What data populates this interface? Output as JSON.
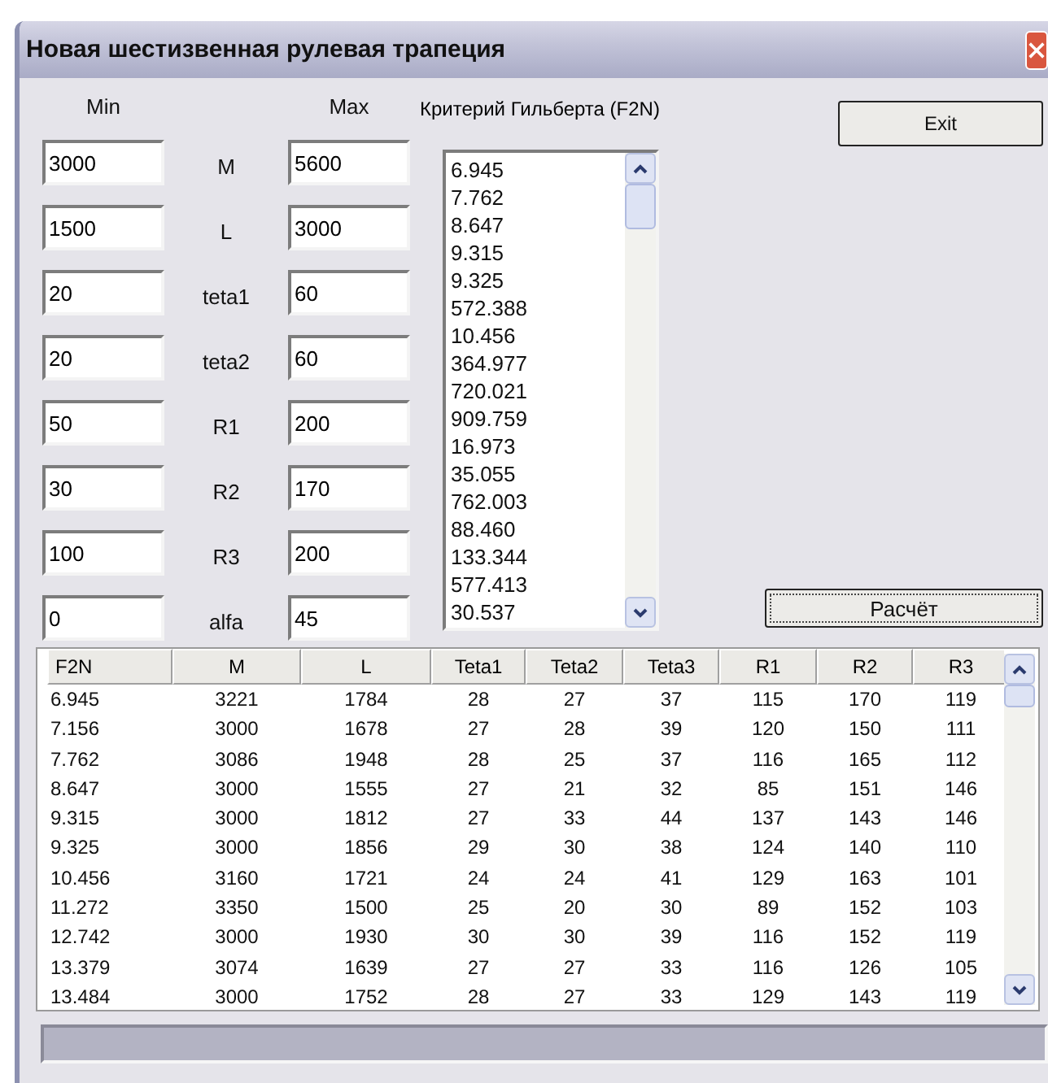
{
  "window": {
    "title": "Новая шестизвенная рулевая трапеция"
  },
  "params": {
    "min_header": "Min",
    "max_header": "Max",
    "rows": [
      {
        "min": "3000",
        "label": "M",
        "max": "5600"
      },
      {
        "min": "1500",
        "label": "L",
        "max": "3000"
      },
      {
        "min": "20",
        "label": "teta1",
        "max": "60"
      },
      {
        "min": "20",
        "label": "teta2",
        "max": "60"
      },
      {
        "min": "50",
        "label": "R1",
        "max": "200"
      },
      {
        "min": "30",
        "label": "R2",
        "max": "170"
      },
      {
        "min": "100",
        "label": "R3",
        "max": "200"
      },
      {
        "min": "0",
        "label": "alfa",
        "max": "45"
      }
    ]
  },
  "criterion": {
    "label": "Критерий Гильберта (F2N)",
    "items": [
      "6.945",
      "7.762",
      "8.647",
      "9.315",
      "9.325",
      "572.388",
      "10.456",
      "364.977",
      "720.021",
      "909.759",
      "16.973",
      "35.055",
      "762.003",
      "88.460",
      "133.344",
      "577.413",
      "30.537"
    ]
  },
  "buttons": {
    "exit": "Exit",
    "calculate": "Расчёт"
  },
  "table": {
    "columns": [
      "F2N",
      "M",
      "L",
      "Teta1",
      "Teta2",
      "Teta3",
      "R1",
      "R2",
      "R3"
    ],
    "rows": [
      [
        "6.945",
        "3221",
        "1784",
        "28",
        "27",
        "37",
        "115",
        "170",
        "119"
      ],
      [
        "7.156",
        "3000",
        "1678",
        "27",
        "28",
        "39",
        "120",
        "150",
        "111"
      ],
      [
        "7.762",
        "3086",
        "1948",
        "28",
        "25",
        "37",
        "116",
        "165",
        "112"
      ],
      [
        "8.647",
        "3000",
        "1555",
        "27",
        "21",
        "32",
        "85",
        "151",
        "146"
      ],
      [
        "9.315",
        "3000",
        "1812",
        "27",
        "33",
        "44",
        "137",
        "143",
        "146"
      ],
      [
        "9.325",
        "3000",
        "1856",
        "29",
        "30",
        "38",
        "124",
        "140",
        "110"
      ],
      [
        "10.456",
        "3160",
        "1721",
        "24",
        "24",
        "41",
        "129",
        "163",
        "101"
      ],
      [
        "11.272",
        "3350",
        "1500",
        "25",
        "20",
        "30",
        "89",
        "152",
        "103"
      ],
      [
        "12.742",
        "3000",
        "1930",
        "30",
        "30",
        "39",
        "116",
        "152",
        "119"
      ],
      [
        "13.379",
        "3074",
        "1639",
        "27",
        "27",
        "33",
        "116",
        "126",
        "105"
      ],
      [
        "13.484",
        "3000",
        "1752",
        "28",
        "27",
        "33",
        "129",
        "143",
        "119"
      ]
    ]
  }
}
